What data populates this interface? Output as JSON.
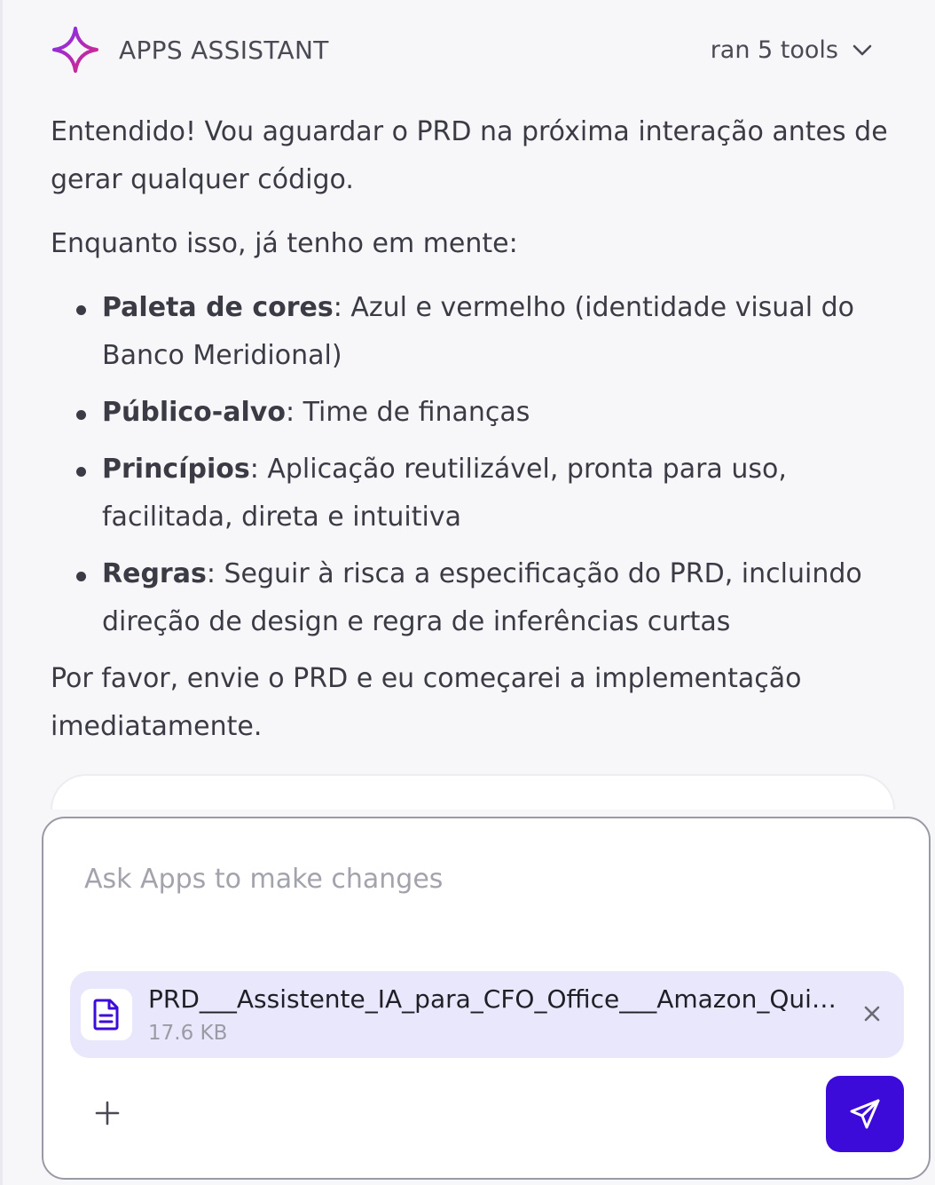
{
  "header": {
    "title": "APPS ASSISTANT",
    "tools_label": "ran 5 tools",
    "logo_icon": "sparkle-icon",
    "chevron_icon": "chevron-down-icon"
  },
  "message": {
    "intro": "Entendido! Vou aguardar o PRD na próxima interação antes de gerar qualquer código.",
    "lead": "Enquanto isso, já tenho em mente:",
    "bullets": [
      {
        "term": "Paleta de cores",
        "text": ": Azul e vermelho (identidade visual do Banco Meridional)"
      },
      {
        "term": "Público-alvo",
        "text": ": Time de finanças"
      },
      {
        "term": "Princípios",
        "text": ": Aplicação reutilizável, pronta para uso, facilitada, direta e intuitiva"
      },
      {
        "term": "Regras",
        "text": ": Seguir à risca a especificação do PRD, incluindo direção de design e regra de inferências curtas"
      }
    ],
    "closing": "Por favor, envie o PRD e eu começarei a implementação imediatamente."
  },
  "composer": {
    "placeholder": "Ask Apps to make changes",
    "attachment": {
      "name": "PRD___Assistente_IA_para_CFO_Office___Amazon_Quick...",
      "size": "17.6 KB",
      "icon": "document-icon"
    },
    "add_icon": "plus-icon",
    "send_icon": "send-icon",
    "remove_icon": "close-icon"
  },
  "colors": {
    "accent": "#3d0bd9",
    "attachment_bg": "#e9e7fb",
    "logo_gradient_start": "#7b2ff7",
    "logo_gradient_end": "#e0287a"
  }
}
